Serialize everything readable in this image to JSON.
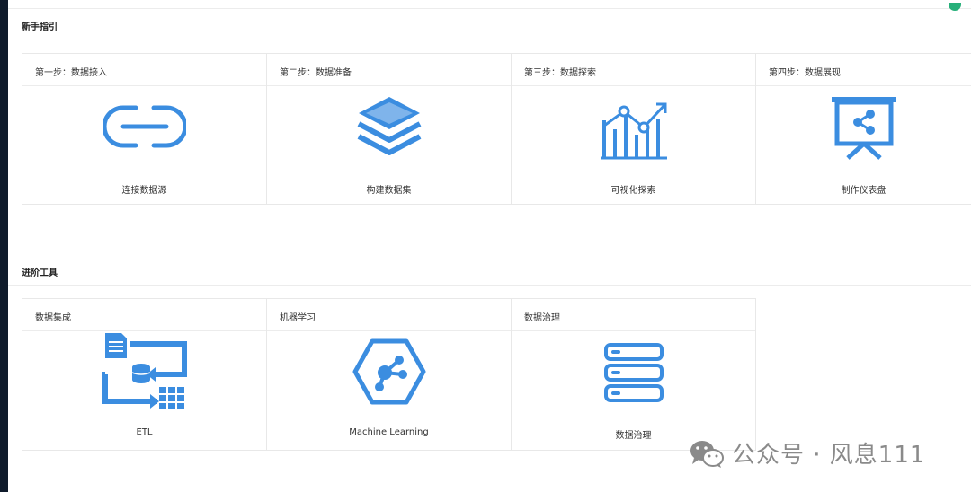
{
  "colors": {
    "accent": "#3b8de0",
    "sidebar": "#0f1b2b",
    "border": "#e8e8e8"
  },
  "guide": {
    "title": "新手指引",
    "cards": [
      {
        "step": "第一步：数据接入",
        "label": "连接数据源",
        "icon": "link-icon"
      },
      {
        "step": "第二步：数据准备",
        "label": "构建数据集",
        "icon": "layers-icon"
      },
      {
        "step": "第三步：数据探索",
        "label": "可视化探索",
        "icon": "chart-icon"
      },
      {
        "step": "第四步：数据展现",
        "label": "制作仪表盘",
        "icon": "presentation-icon"
      }
    ]
  },
  "advanced": {
    "title": "进阶工具",
    "cards": [
      {
        "name": "数据集成",
        "label": "ETL",
        "icon": "etl-icon"
      },
      {
        "name": "机器学习",
        "label": "Machine Learning",
        "icon": "machine-learning-icon"
      },
      {
        "name": "数据治理",
        "label": "数据治理",
        "icon": "database-icon"
      }
    ]
  },
  "watermark": {
    "text": "公众号 · 风息111",
    "icon": "wechat-icon"
  }
}
